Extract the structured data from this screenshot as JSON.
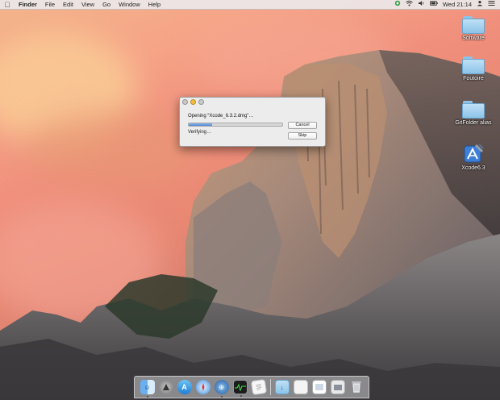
{
  "menubar": {
    "apple_icon": "apple-logo-icon",
    "app_name": "Finder",
    "menus": [
      "File",
      "Edit",
      "View",
      "Go",
      "Window",
      "Help"
    ],
    "status_icons": [
      "status-green-icon",
      "wifi-icon",
      "volume-icon",
      "battery-icon",
      "user-icon"
    ],
    "clock": "Wed 21:14",
    "notification_icon": "notification-center-icon"
  },
  "desktop_icons": [
    {
      "label": "Software",
      "icon": "folder-icon"
    },
    {
      "label": "Foutoire",
      "icon": "folder-icon"
    },
    {
      "label": "GitFolder alias",
      "icon": "folder-alias-icon"
    },
    {
      "label": "Xcode6.3",
      "icon": "xcode-icon"
    }
  ],
  "dialog": {
    "opening_text": "Opening “Xcode_6.3.2.dmg”…",
    "status_text": "Verifying…",
    "progress": 0.25,
    "cancel_label": "Cancel",
    "skip_label": "Skip"
  },
  "dock": {
    "items": [
      "finder-icon",
      "launchpad-icon",
      "app-store-icon",
      "safari-icon",
      "network-icon",
      "activity-monitor-icon",
      "textedit-icon",
      "downloads-folder-icon",
      "document-icon",
      "preview-icon",
      "image-stack-icon",
      "trash-icon"
    ]
  },
  "colors": {
    "accent": "#4a87d8",
    "menubar": "#ece8e9"
  }
}
